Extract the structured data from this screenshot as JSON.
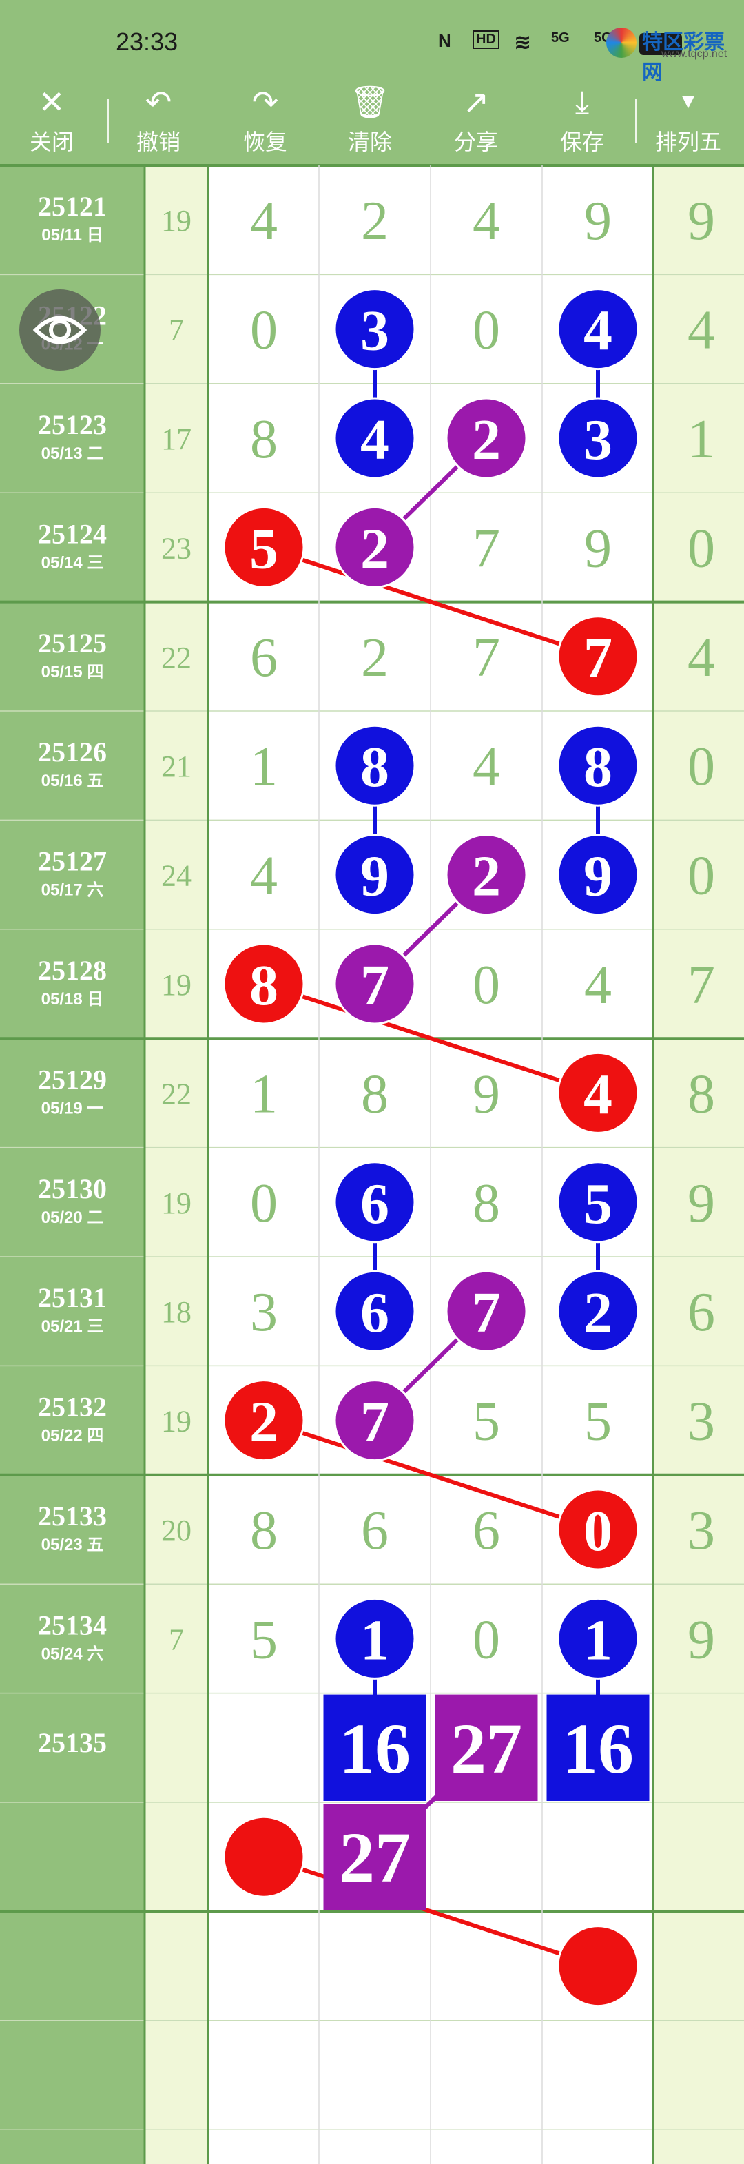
{
  "status": {
    "time": "23:33",
    "icons": [
      "nfc-icon",
      "hd-icon",
      "wifi-icon",
      "5g-signal-icon",
      "5g-signal-icon-2",
      "battery-icon"
    ],
    "icon_texts": [
      "N",
      "HD",
      "≋",
      "5G",
      "5G",
      "▭"
    ]
  },
  "watermark": {
    "name": "特区彩票网",
    "url": "www.tqcp.net"
  },
  "toolbar": [
    {
      "key": "close",
      "label": "关闭",
      "icon": "close-icon",
      "glyph": "✕"
    },
    {
      "key": "undo",
      "label": "撤销",
      "icon": "undo-icon",
      "glyph": "↶"
    },
    {
      "key": "redo",
      "label": "恢复",
      "icon": "redo-icon",
      "glyph": "↷"
    },
    {
      "key": "clear",
      "label": "清除",
      "icon": "trash-icon",
      "glyph": "🗑"
    },
    {
      "key": "share",
      "label": "分享",
      "icon": "share-icon",
      "glyph": "↗"
    },
    {
      "key": "save",
      "label": "保存",
      "icon": "download-icon",
      "glyph": "⤓"
    },
    {
      "key": "type",
      "label": "排列五",
      "icon": "dropdown-triangle-icon",
      "glyph": "▼"
    }
  ],
  "colors": {
    "header_green": "#92c07c",
    "id_col_green": "#92c07c",
    "side_col": "#f0f7d8",
    "number_green": "#8dbf78",
    "grid_line": "#dcdcdc",
    "separator": "#5d9a4b",
    "red": "#ee1111",
    "blue": "#1111dd",
    "purple": "#9b19ac"
  },
  "rows": [
    {
      "id": "25121",
      "date": "05/11 日",
      "sum": "19",
      "digits": [
        "4",
        "2",
        "4",
        "9",
        "9"
      ],
      "marks": {}
    },
    {
      "id": "25122",
      "date": "05/12 一",
      "sum": "7",
      "digits": [
        "0",
        "3",
        "0",
        "4",
        "4"
      ],
      "marks": {
        "1": "blue",
        "3": "blue"
      }
    },
    {
      "id": "25123",
      "date": "05/13 二",
      "sum": "17",
      "digits": [
        "8",
        "4",
        "2",
        "3",
        "1"
      ],
      "marks": {
        "1": "blue",
        "2": "purple",
        "3": "blue"
      }
    },
    {
      "id": "25124",
      "date": "05/14 三",
      "sum": "23",
      "digits": [
        "5",
        "2",
        "7",
        "9",
        "0"
      ],
      "marks": {
        "0": "red",
        "1": "purple"
      }
    },
    {
      "id": "25125",
      "date": "05/15 四",
      "sum": "22",
      "digits": [
        "6",
        "2",
        "7",
        "7",
        "4"
      ],
      "marks": {
        "3": "red"
      }
    },
    {
      "id": "25126",
      "date": "05/16 五",
      "sum": "21",
      "digits": [
        "1",
        "8",
        "4",
        "8",
        "0"
      ],
      "marks": {
        "1": "blue",
        "3": "blue"
      }
    },
    {
      "id": "25127",
      "date": "05/17 六",
      "sum": "24",
      "digits": [
        "4",
        "9",
        "2",
        "9",
        "0"
      ],
      "marks": {
        "1": "blue",
        "2": "purple",
        "3": "blue"
      }
    },
    {
      "id": "25128",
      "date": "05/18 日",
      "sum": "19",
      "digits": [
        "8",
        "7",
        "0",
        "4",
        "7"
      ],
      "marks": {
        "0": "red",
        "1": "purple"
      }
    },
    {
      "id": "25129",
      "date": "05/19 一",
      "sum": "22",
      "digits": [
        "1",
        "8",
        "9",
        "4",
        "8"
      ],
      "marks": {
        "3": "red"
      }
    },
    {
      "id": "25130",
      "date": "05/20 二",
      "sum": "19",
      "digits": [
        "0",
        "6",
        "8",
        "5",
        "9"
      ],
      "marks": {
        "1": "blue",
        "3": "blue"
      }
    },
    {
      "id": "25131",
      "date": "05/21 三",
      "sum": "18",
      "digits": [
        "3",
        "6",
        "7",
        "2",
        "6"
      ],
      "marks": {
        "1": "blue",
        "2": "purple",
        "3": "blue"
      }
    },
    {
      "id": "25132",
      "date": "05/22 四",
      "sum": "19",
      "digits": [
        "2",
        "7",
        "5",
        "5",
        "3"
      ],
      "marks": {
        "0": "red",
        "1": "purple"
      }
    },
    {
      "id": "25133",
      "date": "05/23 五",
      "sum": "20",
      "digits": [
        "8",
        "6",
        "6",
        "0",
        "3"
      ],
      "marks": {
        "3": "red"
      }
    },
    {
      "id": "25134",
      "date": "05/24 六",
      "sum": "7",
      "digits": [
        "5",
        "1",
        "0",
        "1",
        "9"
      ],
      "marks": {
        "1": "blue",
        "3": "blue"
      }
    },
    {
      "id": "25135",
      "date": "",
      "sum": "",
      "digits": [
        "",
        "16",
        "27",
        "16",
        ""
      ],
      "marks": {
        "1": "blue-box",
        "2": "purple-box",
        "3": "blue-box"
      }
    },
    {
      "id": "",
      "date": "",
      "sum": "",
      "digits": [
        "",
        "27",
        "",
        "",
        ""
      ],
      "marks": {
        "0": "red-dot",
        "1": "purple-box"
      }
    },
    {
      "id": "",
      "date": "",
      "sum": "",
      "digits": [
        "",
        "",
        "",
        "",
        ""
      ],
      "marks": {
        "3": "red-dot"
      }
    },
    {
      "id": "",
      "date": "",
      "sum": "",
      "digits": [
        "",
        "",
        "",
        "",
        ""
      ],
      "marks": {}
    },
    {
      "id": "",
      "date": "",
      "sum": "",
      "digits": [
        "",
        "",
        "",
        "",
        ""
      ],
      "marks": {}
    }
  ],
  "links": [
    {
      "from": [
        1,
        1
      ],
      "to": [
        2,
        1
      ],
      "color": "blue"
    },
    {
      "from": [
        1,
        3
      ],
      "to": [
        2,
        3
      ],
      "color": "blue"
    },
    {
      "from": [
        2,
        2
      ],
      "to": [
        3,
        1
      ],
      "color": "purple"
    },
    {
      "from": [
        3,
        0
      ],
      "to": [
        4,
        3
      ],
      "color": "red"
    },
    {
      "from": [
        5,
        1
      ],
      "to": [
        6,
        1
      ],
      "color": "blue"
    },
    {
      "from": [
        5,
        3
      ],
      "to": [
        6,
        3
      ],
      "color": "blue"
    },
    {
      "from": [
        6,
        2
      ],
      "to": [
        7,
        1
      ],
      "color": "purple"
    },
    {
      "from": [
        7,
        0
      ],
      "to": [
        8,
        3
      ],
      "color": "red"
    },
    {
      "from": [
        9,
        1
      ],
      "to": [
        10,
        1
      ],
      "color": "blue"
    },
    {
      "from": [
        9,
        3
      ],
      "to": [
        10,
        3
      ],
      "color": "blue"
    },
    {
      "from": [
        10,
        2
      ],
      "to": [
        11,
        1
      ],
      "color": "purple"
    },
    {
      "from": [
        11,
        0
      ],
      "to": [
        12,
        3
      ],
      "color": "red"
    },
    {
      "from": [
        13,
        1
      ],
      "to": [
        14,
        1
      ],
      "color": "blue"
    },
    {
      "from": [
        13,
        3
      ],
      "to": [
        14,
        3
      ],
      "color": "blue"
    },
    {
      "from": [
        14,
        2
      ],
      "to": [
        15,
        1
      ],
      "color": "purple"
    },
    {
      "from": [
        15,
        0
      ],
      "to": [
        16,
        3
      ],
      "color": "red"
    }
  ],
  "eye_button": {
    "icon": "eye-icon"
  }
}
